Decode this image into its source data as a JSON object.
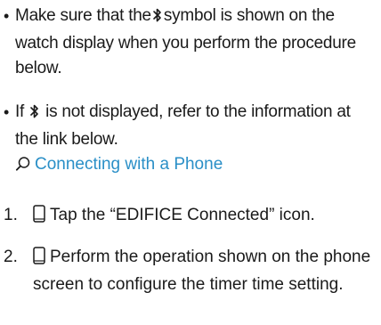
{
  "bullets": [
    {
      "text_before": "Make sure that the",
      "icon": "bluetooth-icon",
      "text_after": "symbol is shown on the watch display when you perform the procedure below."
    },
    {
      "text_before": "If",
      "icon": "bluetooth-icon",
      "text_after": "is not displayed, refer to the information at the link below.",
      "link": {
        "icon": "search-icon",
        "label": "Connecting with a Phone"
      }
    }
  ],
  "steps": [
    {
      "number": "1.",
      "icon": "phone-icon",
      "text": "Tap the “EDIFICE Connected” icon."
    },
    {
      "number": "2.",
      "icon": "phone-icon",
      "text": "Perform the operation shown on the phone screen to configure the timer time setting."
    }
  ],
  "colors": {
    "text": "#1a1a1a",
    "link": "#2a8fc7"
  }
}
